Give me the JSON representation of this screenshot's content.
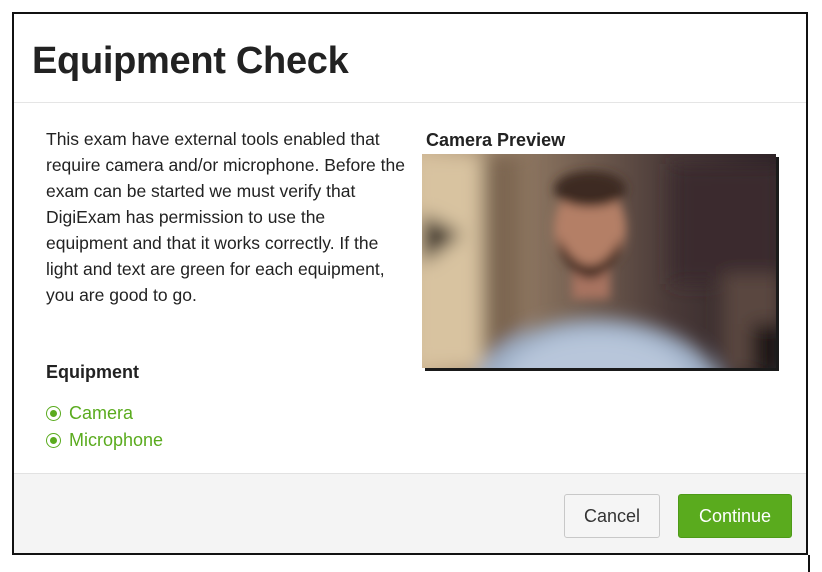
{
  "dialog": {
    "title": "Equipment Check",
    "intro": "This exam have external tools enabled that require camera and/or microphone. Before the exam can be started we must verify that DigiExam has permission to use the equipment and that it works correctly. If the light and text are green for each equipment, you are good to go.",
    "equipment_heading": "Equipment",
    "equipment": [
      {
        "label": "Camera",
        "status": "ok",
        "icon": "status-dot-icon"
      },
      {
        "label": "Microphone",
        "status": "ok",
        "icon": "status-dot-icon"
      }
    ],
    "camera_preview_heading": "Camera Preview",
    "buttons": {
      "cancel": "Cancel",
      "continue": "Continue"
    }
  },
  "colors": {
    "accent_green": "#5aab1e",
    "text": "#222222",
    "footer_bg": "#f4f4f4"
  }
}
